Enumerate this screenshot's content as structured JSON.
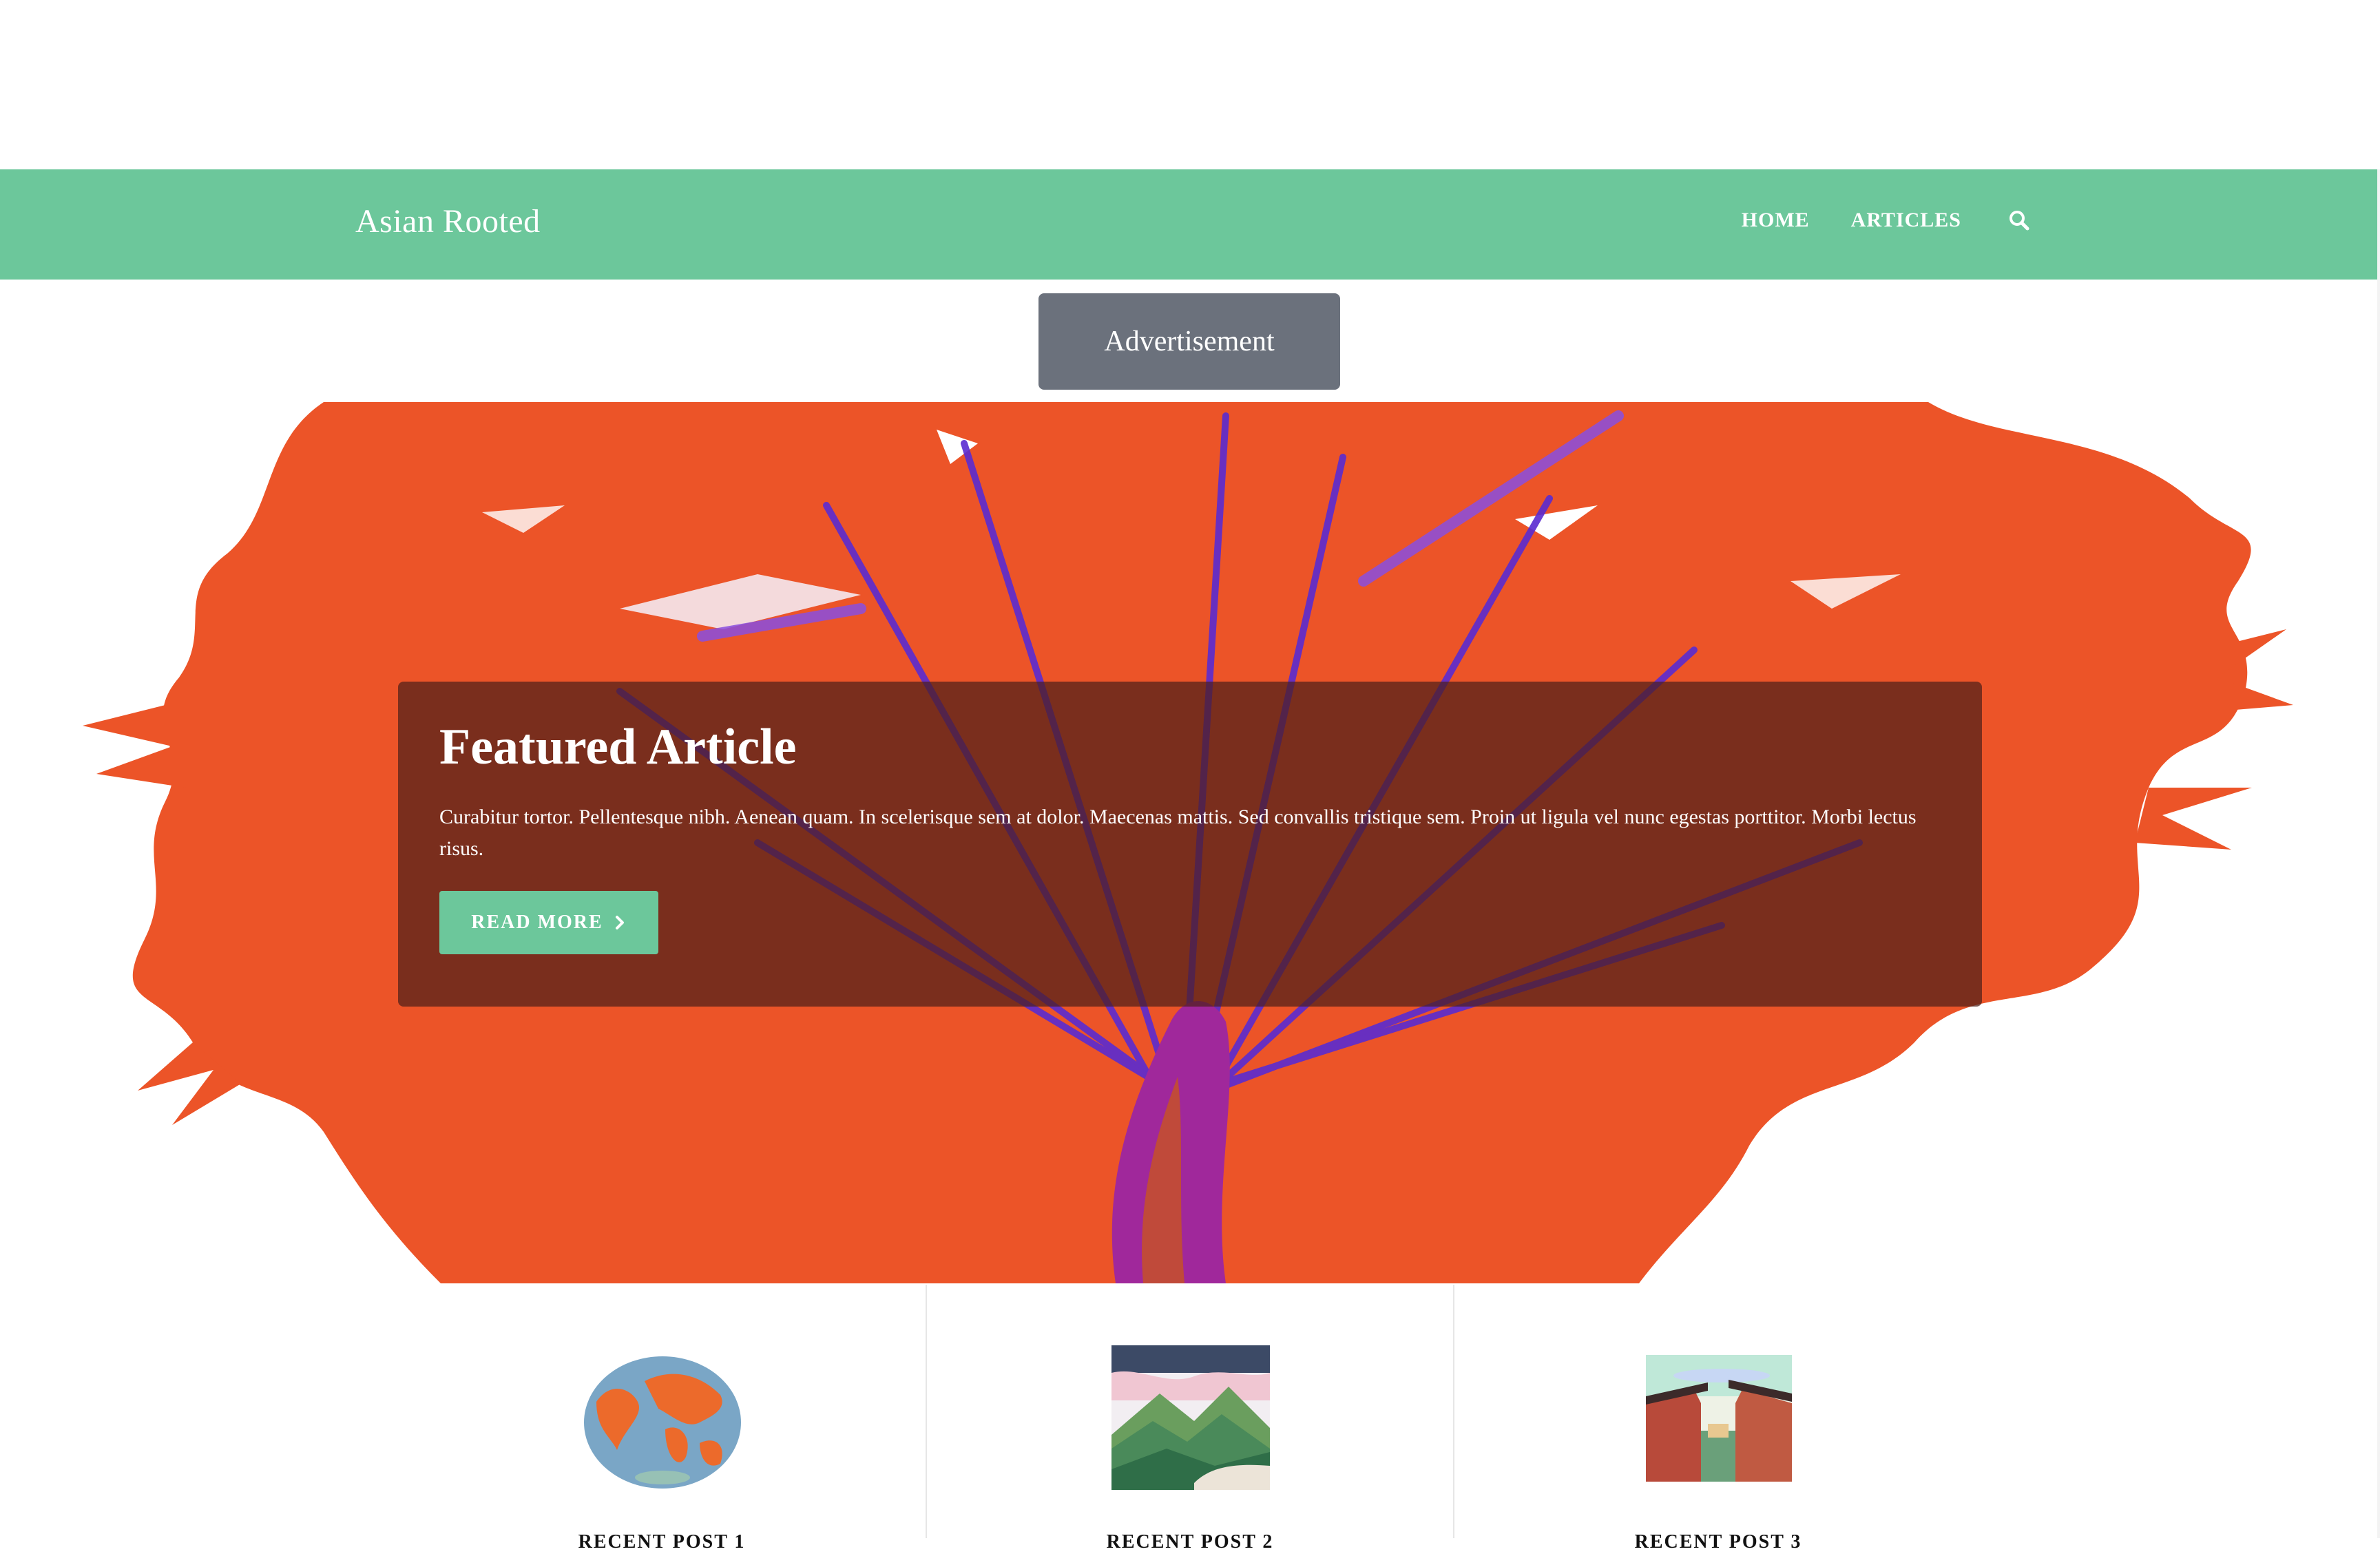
{
  "brand": "Asian Rooted",
  "nav": {
    "home": "HOME",
    "articles": "ARTICLES",
    "search_icon": "search-icon"
  },
  "ad": {
    "label": "Advertisement"
  },
  "featured": {
    "title": "Featured Article",
    "text": "Curabitur tortor. Pellentesque nibh. Aenean quam. In scelerisque sem at dolor. Maecenas mattis. Sed convallis tristique sem. Proin ut ligula vel nunc egestas porttitor. Morbi lectus risus.",
    "button_label": "READ MORE",
    "button_icon": "chevron-right-icon"
  },
  "recent_posts": [
    {
      "title": "RECENT POST 1",
      "thumb": "world-map-illustration"
    },
    {
      "title": "RECENT POST 2",
      "thumb": "mountain-illustration"
    },
    {
      "title": "RECENT POST 3",
      "thumb": "asian-street-illustration"
    }
  ],
  "colors": {
    "accent": "#6cc79b",
    "ad_bg": "#6b717c",
    "hero_orange": "#ec5428",
    "hero_purple": "#5a2bd1"
  }
}
